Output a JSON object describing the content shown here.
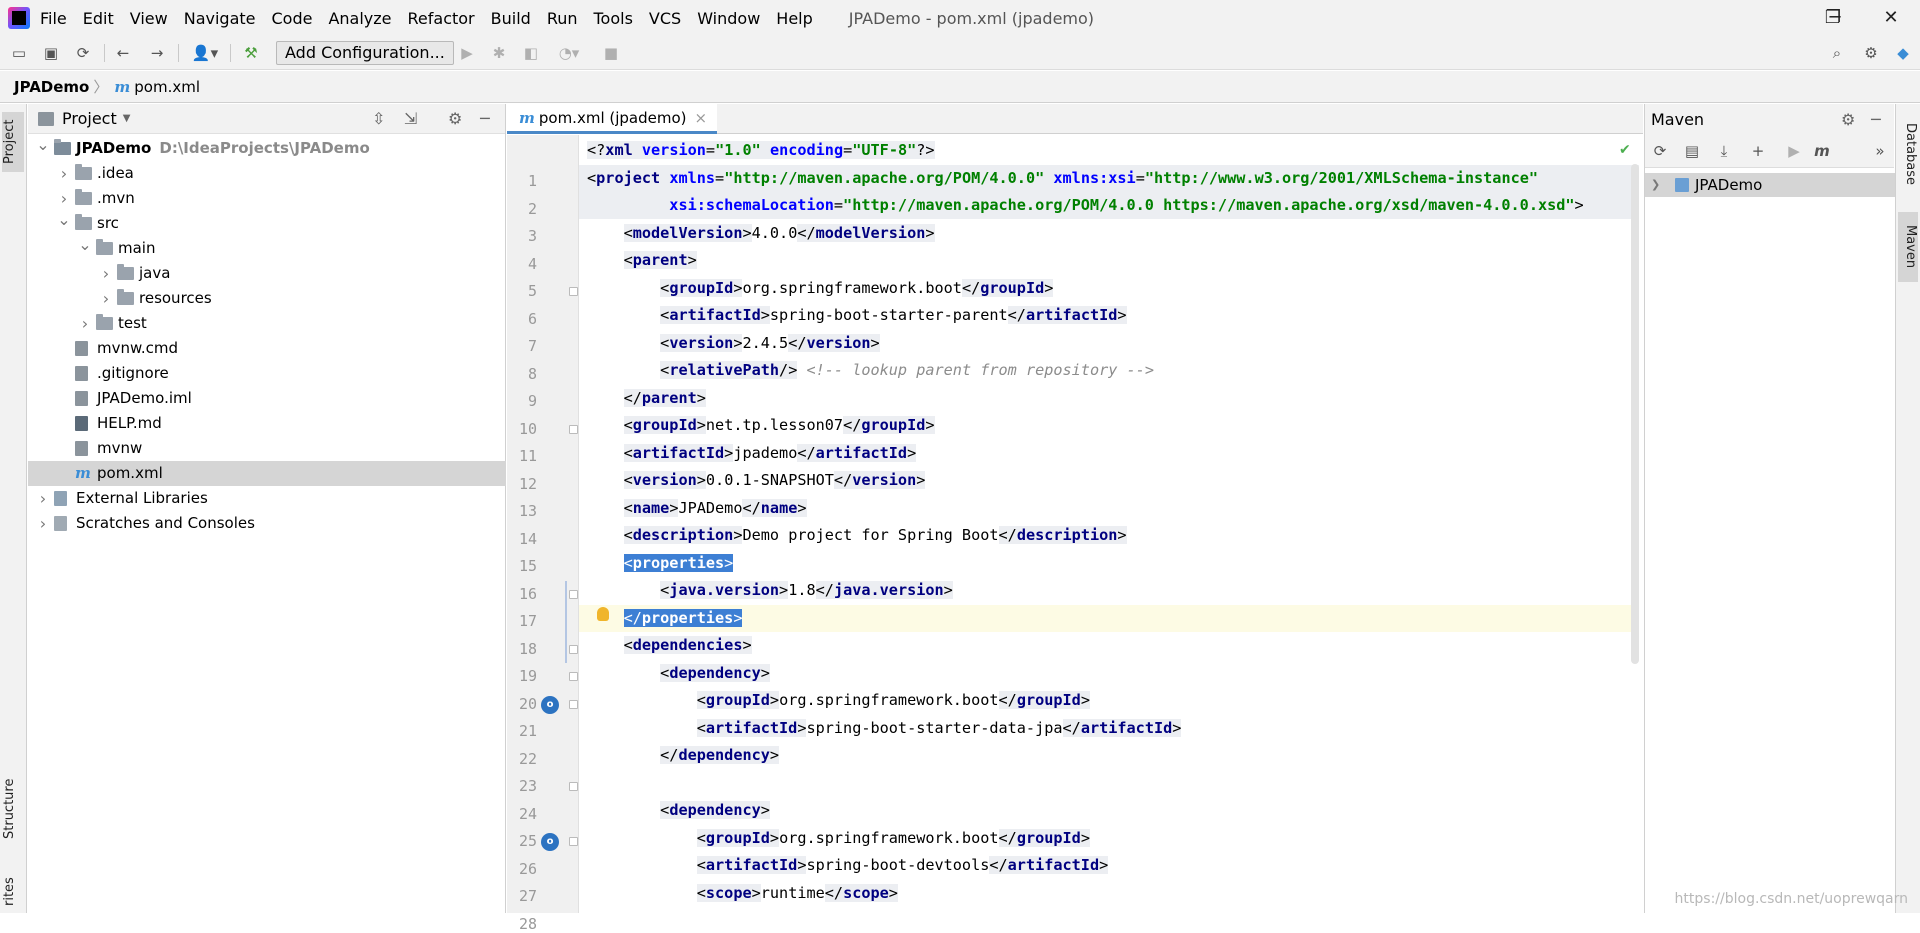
{
  "menubar": {
    "items": [
      "File",
      "Edit",
      "View",
      "Navigate",
      "Code",
      "Analyze",
      "Refactor",
      "Build",
      "Run",
      "Tools",
      "VCS",
      "Window",
      "Help"
    ],
    "window_title": "JPADemo - pom.xml (jpademo)",
    "controls": {
      "minimize": "─",
      "restore": "❐",
      "close": "✕"
    }
  },
  "toolbar": {
    "add_configuration": "Add Configuration...",
    "icons": [
      "open-icon",
      "save-icon",
      "sync-icon",
      "back-icon",
      "forward-icon",
      "user-icon",
      "build-icon",
      "run-icon",
      "debug-icon",
      "coverage-icon",
      "profile-icon",
      "stop-icon",
      "search-icon",
      "settings-icon",
      "toolbox-icon"
    ]
  },
  "breadcrumb": {
    "project": "JPADemo",
    "separator": "〉",
    "file_icon": "m",
    "file": "pom.xml"
  },
  "left_stripe": {
    "project_tab": "Project",
    "structure_tab": "Structure",
    "favorites_tab": "rites"
  },
  "project_panel": {
    "title": "Project",
    "dropdown": "▼",
    "tree": [
      {
        "label": "JPADemo",
        "suffix": "D:\\IdeaProjects\\JPADemo",
        "depth": 0,
        "arrow": "expanded",
        "icon": "module"
      },
      {
        "label": ".idea",
        "depth": 1,
        "arrow": "collapsed",
        "icon": "folder"
      },
      {
        "label": ".mvn",
        "depth": 1,
        "arrow": "collapsed",
        "icon": "folder"
      },
      {
        "label": "src",
        "depth": 1,
        "arrow": "expanded",
        "icon": "folder"
      },
      {
        "label": "main",
        "depth": 2,
        "arrow": "expanded",
        "icon": "folder"
      },
      {
        "label": "java",
        "depth": 3,
        "arrow": "collapsed",
        "icon": "folder"
      },
      {
        "label": "resources",
        "depth": 3,
        "arrow": "collapsed",
        "icon": "folder"
      },
      {
        "label": "test",
        "depth": 2,
        "arrow": "collapsed",
        "icon": "folder"
      },
      {
        "label": "mvnw.cmd",
        "depth": 1,
        "arrow": "none",
        "icon": "file"
      },
      {
        "label": ".gitignore",
        "depth": 1,
        "arrow": "none",
        "icon": "file"
      },
      {
        "label": "JPADemo.iml",
        "depth": 1,
        "arrow": "none",
        "icon": "file"
      },
      {
        "label": "HELP.md",
        "depth": 1,
        "arrow": "none",
        "icon": "md"
      },
      {
        "label": "mvnw",
        "depth": 1,
        "arrow": "none",
        "icon": "file"
      },
      {
        "label": "pom.xml",
        "depth": 1,
        "arrow": "none",
        "icon": "maven",
        "selected": true
      },
      {
        "label": "External Libraries",
        "depth": 0,
        "arrow": "collapsed",
        "icon": "library"
      },
      {
        "label": "Scratches and Consoles",
        "depth": 0,
        "arrow": "collapsed",
        "icon": "scratch"
      }
    ]
  },
  "editor": {
    "tab_label": "pom.xml (jpademo)",
    "tab_close": "×",
    "line_numbers": [
      "1",
      "2",
      "3",
      "4",
      "5",
      "6",
      "7",
      "8",
      "9",
      "10",
      "11",
      "12",
      "13",
      "14",
      "15",
      "16",
      "17",
      "18",
      "19",
      "20",
      "21",
      "22",
      "23",
      "24",
      "25",
      "26",
      "27",
      "28"
    ],
    "lines": [
      "<?xml version=\"1.0\" encoding=\"UTF-8\"?>",
      "<project xmlns=\"http://maven.apache.org/POM/4.0.0\" xmlns:xsi=\"http://www.w3.org/2001/XMLSchema-instance\"",
      "         xsi:schemaLocation=\"http://maven.apache.org/POM/4.0.0 https://maven.apache.org/xsd/maven-4.0.0.xsd\">",
      "    <modelVersion>4.0.0</modelVersion>",
      "    <parent>",
      "        <groupId>org.springframework.boot</groupId>",
      "        <artifactId>spring-boot-starter-parent</artifactId>",
      "        <version>2.4.5</version>",
      "        <relativePath/> <!-- lookup parent from repository -->",
      "    </parent>",
      "    <groupId>net.tp.lesson07</groupId>",
      "    <artifactId>jpademo</artifactId>",
      "    <version>0.0.1-SNAPSHOT</version>",
      "    <name>JPADemo</name>",
      "    <description>Demo project for Spring Boot</description>",
      "    <properties>",
      "        <java.version>1.8</java.version>",
      "    </properties>",
      "    <dependencies>",
      "        <dependency>",
      "            <groupId>org.springframework.boot</groupId>",
      "            <artifactId>spring-boot-starter-data-jpa</artifactId>",
      "        </dependency>",
      "",
      "        <dependency>",
      "            <groupId>org.springframework.boot</groupId>",
      "            <artifactId>spring-boot-devtools</artifactId>",
      "            <scope>runtime</scope>"
    ],
    "current_line": 18,
    "check_mark": "✔"
  },
  "maven_panel": {
    "title": "Maven",
    "project_item": "JPADemo",
    "icons": [
      "reload-icon",
      "generate-sources-icon",
      "download-icon",
      "add-icon",
      "run-icon",
      "maven-goal-icon",
      "more-icon"
    ]
  },
  "right_stripe": {
    "database_tab": "Database",
    "maven_tab": "Maven"
  },
  "watermark": "https://blog.csdn.net/uoprewqarn"
}
